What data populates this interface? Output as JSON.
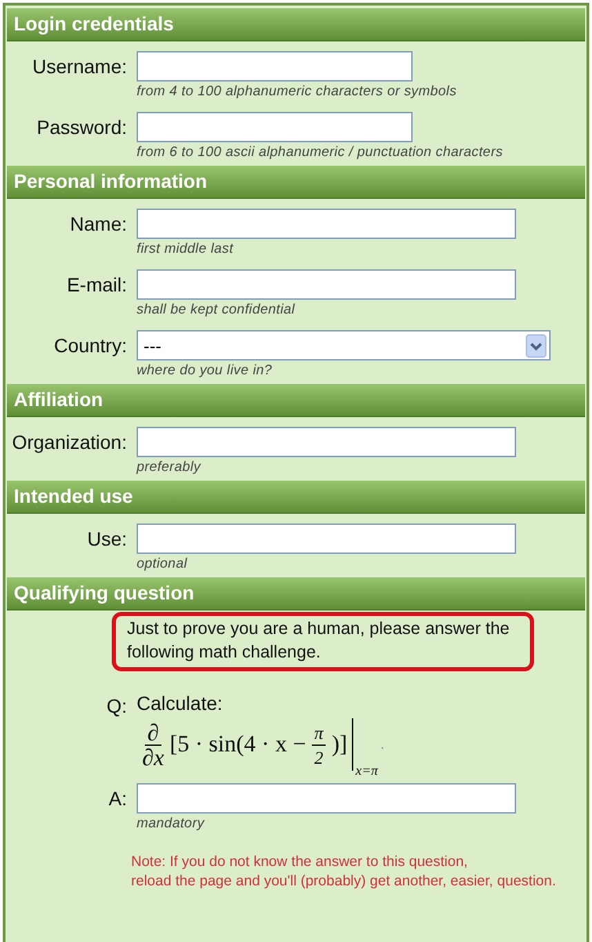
{
  "sections": [
    {
      "title": "Login credentials",
      "items": [
        {
          "kind": "short_text",
          "label": "Username:",
          "hint": "from 4 to 100 alphanumeric characters or symbols"
        },
        {
          "kind": "short_text",
          "label": "Password:",
          "hint": "from 6 to 100 ascii alphanumeric / punctuation characters"
        }
      ]
    },
    {
      "title": "Personal information",
      "items": [
        {
          "kind": "text",
          "label": "Name:",
          "hint": "first middle last"
        },
        {
          "kind": "text",
          "label": "E-mail:",
          "hint": "shall be kept confidential"
        },
        {
          "kind": "select",
          "label": "Country:",
          "value": "---",
          "hint": "where do you live in?"
        }
      ]
    },
    {
      "title": "Affiliation",
      "items": [
        {
          "kind": "text",
          "label": "Organization:",
          "hint": "preferably"
        }
      ]
    },
    {
      "title": "Intended use",
      "items": [
        {
          "kind": "text",
          "label": "Use:",
          "hint": "optional"
        }
      ]
    },
    {
      "title": "Qualifying question",
      "items": [
        {
          "kind": "notice",
          "text": "Just to prove you are a human, please answer the following math challenge."
        },
        {
          "kind": "question",
          "label": "Q:",
          "prompt": "Calculate:",
          "formula": {
            "numerator": "∂",
            "denominator": "∂x",
            "open": "[5 · sin",
            "inner": "(4 · x −",
            "frac_numerator": "π",
            "frac_denominator": "2",
            "close": ")]",
            "eval_at": "x=π",
            "end": "."
          }
        },
        {
          "kind": "text",
          "label": "A:",
          "hint": "mandatory"
        },
        {
          "kind": "note",
          "lines": [
            "Note: If you do not know the answer to this question,",
            "reload the page and you'll (probably) get another, easier, question."
          ]
        }
      ]
    }
  ]
}
